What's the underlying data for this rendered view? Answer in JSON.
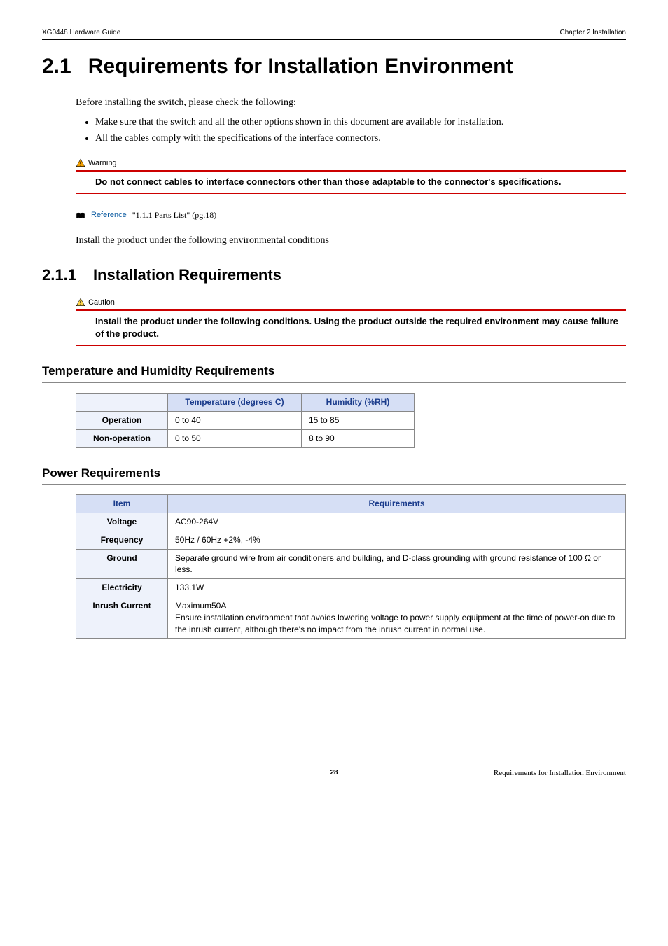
{
  "header": {
    "left": "XG0448 Hardware Guide",
    "right": "Chapter 2 Installation"
  },
  "h1": {
    "num": "2.1",
    "title": "Requirements for Installation Environment"
  },
  "intro": "Before installing the switch, please check the following:",
  "bullets": [
    "Make sure that the switch and all the other options shown in this document are available for installation.",
    "All the cables comply with the specifications of the interface connectors."
  ],
  "warning": {
    "label": "Warning",
    "text": "Do not connect cables to interface connectors other than those adaptable to the connector's specifications."
  },
  "reference": {
    "label": "Reference",
    "text": "\"1.1.1 Parts List\" (pg.18)"
  },
  "installUnder": "Install the product under the following environmental conditions",
  "h2": {
    "num": "2.1.1",
    "title": "Installation Requirements"
  },
  "caution": {
    "label": "Caution",
    "text": "Install the product under the following conditions. Using the product outside the required environment may cause failure of the product."
  },
  "sections": {
    "tempHumidity": {
      "heading": "Temperature and Humidity Requirements",
      "headers": [
        "",
        "Temperature (degrees C)",
        "Humidity (%RH)"
      ],
      "rows": [
        {
          "label": "Operation",
          "temp": "0 to 40",
          "hum": "15 to 85"
        },
        {
          "label": "Non-operation",
          "temp": "0 to 50",
          "hum": "8 to 90"
        }
      ]
    },
    "power": {
      "heading": "Power Requirements",
      "headers": [
        "Item",
        "Requirements"
      ],
      "rows": [
        {
          "item": "Voltage",
          "req": "AC90-264V"
        },
        {
          "item": "Frequency",
          "req": "50Hz / 60Hz  +2%, -4%"
        },
        {
          "item": "Ground",
          "req": "Separate ground wire from air conditioners and building, and D-class grounding with ground resistance of 100 Ω or less."
        },
        {
          "item": "Electricity",
          "req": "133.1W"
        },
        {
          "item": "Inrush Current",
          "req": "Maximum50A\nEnsure installation environment that avoids lowering voltage to power supply equipment at the time of power-on due to the inrush current, although there's no impact from the inrush current in normal use."
        }
      ]
    }
  },
  "footer": {
    "page": "28",
    "right": "Requirements for Installation Environment"
  }
}
